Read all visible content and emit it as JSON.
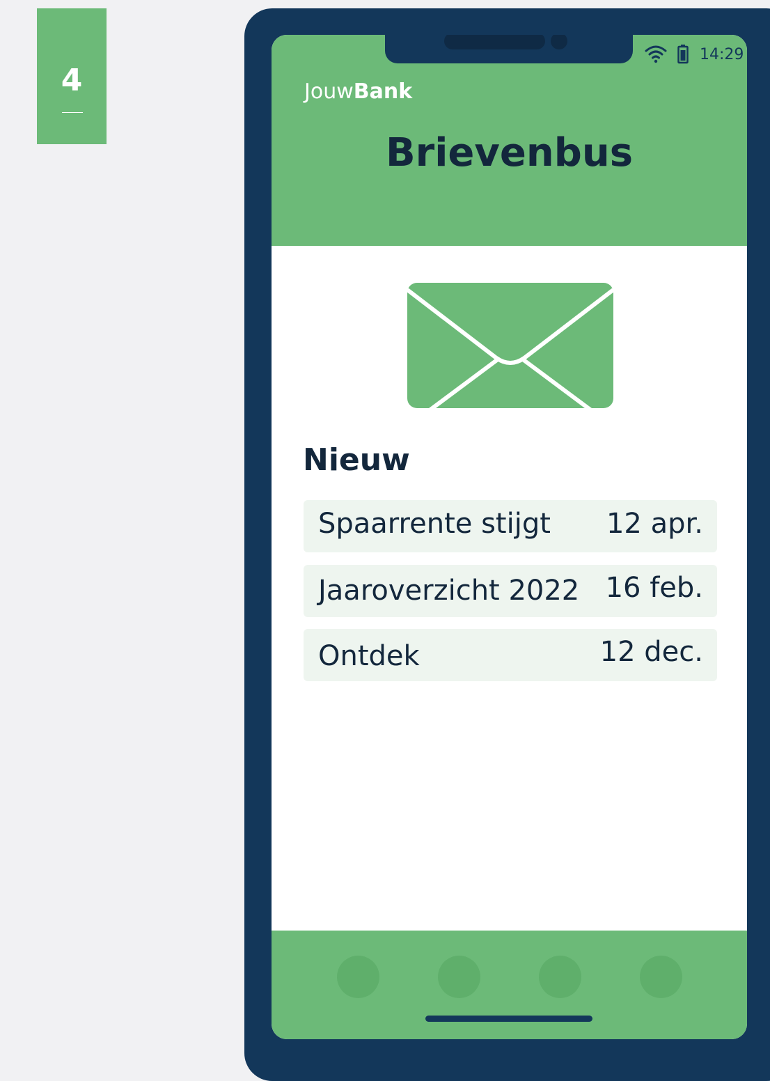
{
  "step": {
    "number": "4"
  },
  "status_bar": {
    "time": "14:29",
    "icons": [
      "wifi-icon",
      "battery-icon"
    ]
  },
  "app": {
    "brand_light": "Jouw",
    "brand_bold": "Bank",
    "title": "Brievenbus"
  },
  "envelope": {
    "icon": "envelope-icon"
  },
  "inbox": {
    "section_title": "Nieuw",
    "items": [
      {
        "subject": "Spaarrente stijgt",
        "date": "12 apr."
      },
      {
        "subject": "Jaaroverzicht 2022",
        "date": "16 feb."
      },
      {
        "subject": "Ontdek",
        "date": "12 dec."
      }
    ]
  },
  "colors": {
    "accent_green": "#6cba78",
    "phone_navy": "#13375a",
    "text_dark": "#13273c",
    "row_background": "#eef5ef",
    "page_background": "#f1f1f3"
  }
}
